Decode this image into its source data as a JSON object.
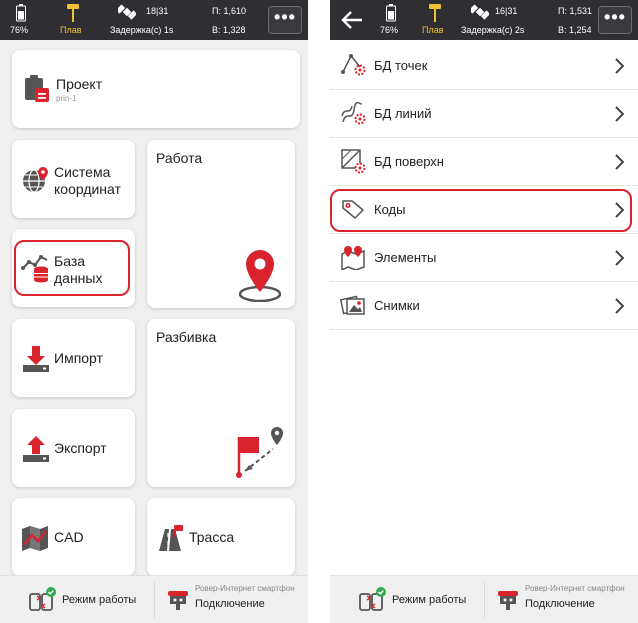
{
  "colors": {
    "accent": "#d9232d",
    "statusbar": "#2f2f33",
    "yellow": "#f1c232"
  },
  "status": {
    "battery": "76%",
    "mode": "Плав",
    "left": {
      "sats": "18|31",
      "delay": "Задержка(с) 1s",
      "p": "П: 1,610",
      "v": "В: 1,328"
    },
    "right": {
      "sats": "16|31",
      "delay": "Задержка(с) 2s",
      "p": "П: 1,531",
      "v": "В: 1,254"
    },
    "more": "•••"
  },
  "menu": {
    "project": {
      "title": "Проект",
      "sub": "prin-1"
    },
    "coord": "Система координат",
    "work": "Работа",
    "database": "База данных",
    "import": "Импорт",
    "stakeout": "Разбивка",
    "export": "Экспорт",
    "cad": "CAD",
    "route": "Трасса"
  },
  "bottom": {
    "work_mode": "Режим работы",
    "device": "Ровер-Интернет смартфон",
    "connection": "Подключение"
  },
  "database_list": [
    {
      "label": "БД точек",
      "icon": "point-db-icon"
    },
    {
      "label": "БД линий",
      "icon": "line-db-icon"
    },
    {
      "label": "БД поверхн",
      "icon": "surface-db-icon"
    },
    {
      "label": "Коды",
      "icon": "tag-icon"
    },
    {
      "label": "Элементы",
      "icon": "map-elements-icon"
    },
    {
      "label": "Снимки",
      "icon": "photos-icon"
    }
  ]
}
